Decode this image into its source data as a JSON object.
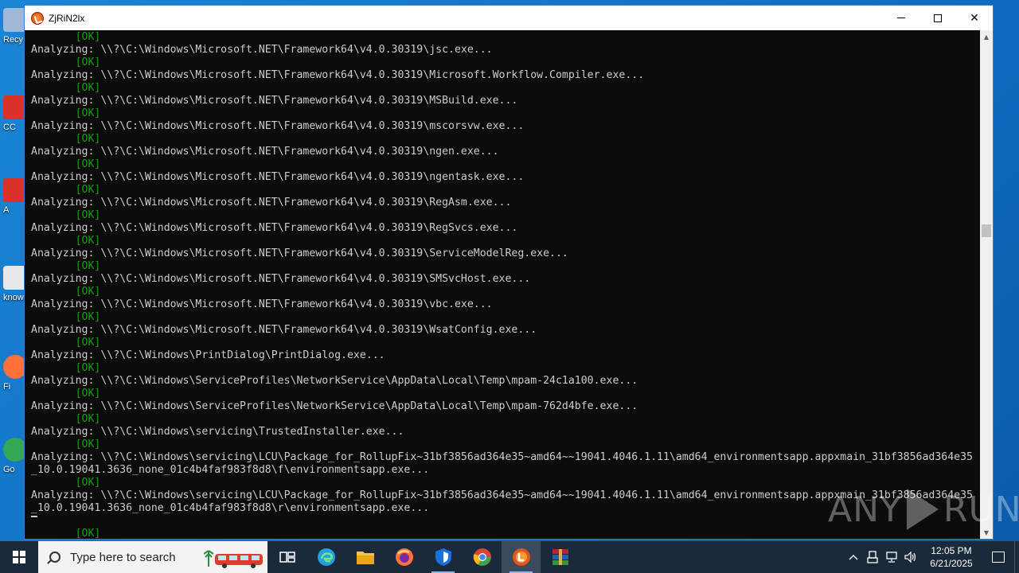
{
  "desktop": {
    "icons": [
      {
        "label": "Recy",
        "color": "#9fb9d6"
      },
      {
        "label": "CC",
        "color": "#d8322a"
      },
      {
        "label": "A",
        "color": "#d8322a"
      },
      {
        "label": "know",
        "color": "#e8e8e8"
      },
      {
        "label": "Fi",
        "color": "#ff7139"
      },
      {
        "label": "Go",
        "color": "#34a853"
      }
    ]
  },
  "window": {
    "title": "ZjRiN2lx",
    "controls": {
      "minimize": "minimize",
      "maximize": "maximize",
      "close": "✕"
    }
  },
  "console": {
    "lines": [
      {
        "type": "ok",
        "text": "       [OK]"
      },
      {
        "type": "text",
        "text": "Analyzing: \\\\?\\C:\\Windows\\Microsoft.NET\\Framework64\\v4.0.30319\\jsc.exe..."
      },
      {
        "type": "ok",
        "text": "       [OK]"
      },
      {
        "type": "text",
        "text": "Analyzing: \\\\?\\C:\\Windows\\Microsoft.NET\\Framework64\\v4.0.30319\\Microsoft.Workflow.Compiler.exe..."
      },
      {
        "type": "ok",
        "text": "       [OK]"
      },
      {
        "type": "text",
        "text": "Analyzing: \\\\?\\C:\\Windows\\Microsoft.NET\\Framework64\\v4.0.30319\\MSBuild.exe..."
      },
      {
        "type": "ok",
        "text": "       [OK]"
      },
      {
        "type": "text",
        "text": "Analyzing: \\\\?\\C:\\Windows\\Microsoft.NET\\Framework64\\v4.0.30319\\mscorsvw.exe..."
      },
      {
        "type": "ok",
        "text": "       [OK]"
      },
      {
        "type": "text",
        "text": "Analyzing: \\\\?\\C:\\Windows\\Microsoft.NET\\Framework64\\v4.0.30319\\ngen.exe..."
      },
      {
        "type": "ok",
        "text": "       [OK]"
      },
      {
        "type": "text",
        "text": "Analyzing: \\\\?\\C:\\Windows\\Microsoft.NET\\Framework64\\v4.0.30319\\ngentask.exe..."
      },
      {
        "type": "ok",
        "text": "       [OK]"
      },
      {
        "type": "text",
        "text": "Analyzing: \\\\?\\C:\\Windows\\Microsoft.NET\\Framework64\\v4.0.30319\\RegAsm.exe..."
      },
      {
        "type": "ok",
        "text": "       [OK]"
      },
      {
        "type": "text",
        "text": "Analyzing: \\\\?\\C:\\Windows\\Microsoft.NET\\Framework64\\v4.0.30319\\RegSvcs.exe..."
      },
      {
        "type": "ok",
        "text": "       [OK]"
      },
      {
        "type": "text",
        "text": "Analyzing: \\\\?\\C:\\Windows\\Microsoft.NET\\Framework64\\v4.0.30319\\ServiceModelReg.exe..."
      },
      {
        "type": "ok",
        "text": "       [OK]"
      },
      {
        "type": "text",
        "text": "Analyzing: \\\\?\\C:\\Windows\\Microsoft.NET\\Framework64\\v4.0.30319\\SMSvcHost.exe..."
      },
      {
        "type": "ok",
        "text": "       [OK]"
      },
      {
        "type": "text",
        "text": "Analyzing: \\\\?\\C:\\Windows\\Microsoft.NET\\Framework64\\v4.0.30319\\vbc.exe..."
      },
      {
        "type": "ok",
        "text": "       [OK]"
      },
      {
        "type": "text",
        "text": "Analyzing: \\\\?\\C:\\Windows\\Microsoft.NET\\Framework64\\v4.0.30319\\WsatConfig.exe..."
      },
      {
        "type": "ok",
        "text": "       [OK]"
      },
      {
        "type": "text",
        "text": "Analyzing: \\\\?\\C:\\Windows\\PrintDialog\\PrintDialog.exe..."
      },
      {
        "type": "ok",
        "text": "       [OK]"
      },
      {
        "type": "text",
        "text": "Analyzing: \\\\?\\C:\\Windows\\ServiceProfiles\\NetworkService\\AppData\\Local\\Temp\\mpam-24c1a100.exe..."
      },
      {
        "type": "ok",
        "text": "       [OK]"
      },
      {
        "type": "text",
        "text": "Analyzing: \\\\?\\C:\\Windows\\ServiceProfiles\\NetworkService\\AppData\\Local\\Temp\\mpam-762d4bfe.exe..."
      },
      {
        "type": "ok",
        "text": "       [OK]"
      },
      {
        "type": "text",
        "text": "Analyzing: \\\\?\\C:\\Windows\\servicing\\TrustedInstaller.exe..."
      },
      {
        "type": "ok",
        "text": "       [OK]"
      },
      {
        "type": "text",
        "text": "Analyzing: \\\\?\\C:\\Windows\\servicing\\LCU\\Package_for_RollupFix~31bf3856ad364e35~amd64~~19041.4046.1.11\\amd64_environmentsapp.appxmain_31bf3856ad364e35"
      },
      {
        "type": "text",
        "text": "_10.0.19041.3636_none_01c4b4faf983f8d8\\f\\environmentsapp.exe..."
      },
      {
        "type": "ok",
        "text": "       [OK]"
      },
      {
        "type": "text",
        "text": "Analyzing: \\\\?\\C:\\Windows\\servicing\\LCU\\Package_for_RollupFix~31bf3856ad364e35~amd64~~19041.4046.1.11\\amd64_environmentsapp.appxmain_31bf3856ad364e35"
      },
      {
        "type": "text",
        "text": "_10.0.19041.3636_none_01c4b4faf983f8d8\\r\\environmentsapp.exe..."
      },
      {
        "type": "text",
        "text": ""
      },
      {
        "type": "ok",
        "text": "       [OK]"
      }
    ]
  },
  "watermark": {
    "left": "ANY",
    "right": "RUN"
  },
  "taskbar": {
    "search_placeholder": "Type here to search",
    "apps": [
      {
        "name": "task-view",
        "color": "#ffffff"
      },
      {
        "name": "edge",
        "color": "#1fa1e0"
      },
      {
        "name": "file-explorer",
        "color": "#f5c542"
      },
      {
        "name": "firefox",
        "color": "#ff7139"
      },
      {
        "name": "defender",
        "color": "#1e6fd9"
      },
      {
        "name": "chrome",
        "color": "#34a853"
      },
      {
        "name": "active-app",
        "color": "#e0561b"
      },
      {
        "name": "winrar",
        "color": "#b3262d"
      }
    ],
    "clock_time": "12:05 PM",
    "clock_date": "6/21/2025"
  },
  "colors": {
    "console_bg": "#0c0c0c",
    "console_text": "#cccccc",
    "ok_text": "#13a10e",
    "taskbar_bg": "#1b2a3a"
  }
}
